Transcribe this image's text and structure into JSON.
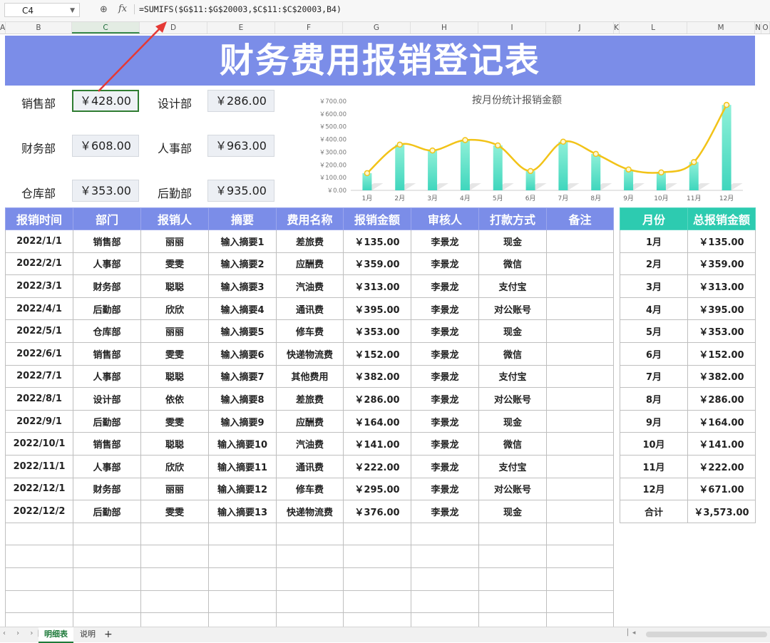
{
  "formula_bar": {
    "cell_ref": "C4",
    "fx": "fx",
    "formula": "=SUMIFS($G$11:$G$20003,$C$11:$C$20003,B4)"
  },
  "columns": [
    "A",
    "B",
    "C",
    "D",
    "E",
    "F",
    "G",
    "H",
    "I",
    "J",
    "K",
    "L",
    "M",
    "N",
    "O"
  ],
  "title": "财务费用报销登记表",
  "dept_summary": [
    {
      "label": "销售部",
      "value": "￥428.00"
    },
    {
      "label": "设计部",
      "value": "￥286.00"
    },
    {
      "label": "财务部",
      "value": "￥608.00"
    },
    {
      "label": "人事部",
      "value": "￥963.00"
    },
    {
      "label": "仓库部",
      "value": "￥353.00"
    },
    {
      "label": "后勤部",
      "value": "￥935.00"
    }
  ],
  "chart_data": {
    "type": "bar",
    "title": "按月份统计报销金额",
    "categories": [
      "1月",
      "2月",
      "3月",
      "4月",
      "5月",
      "6月",
      "7月",
      "8月",
      "9月",
      "10月",
      "11月",
      "12月"
    ],
    "values": [
      135,
      359,
      313,
      395,
      353,
      152,
      382,
      286,
      164,
      141,
      222,
      671
    ],
    "yticks": [
      "￥0.00",
      "￥100.00",
      "￥200.00",
      "￥300.00",
      "￥400.00",
      "￥500.00",
      "￥600.00",
      "￥700.00"
    ],
    "ylim": [
      0,
      700
    ],
    "overlay": "smooth line",
    "colors": {
      "bar": "#3fd6bd",
      "line": "#f2c318"
    }
  },
  "main_table": {
    "headers": [
      "报销时间",
      "部门",
      "报销人",
      "摘要",
      "费用名称",
      "报销金额",
      "审核人",
      "打款方式",
      "备注"
    ],
    "rows": [
      [
        "2022/1/1",
        "销售部",
        "丽丽",
        "输入摘要1",
        "差旅费",
        "￥135.00",
        "李景龙",
        "现金",
        ""
      ],
      [
        "2022/2/1",
        "人事部",
        "雯雯",
        "输入摘要2",
        "应酬费",
        "￥359.00",
        "李景龙",
        "微信",
        ""
      ],
      [
        "2022/3/1",
        "财务部",
        "聪聪",
        "输入摘要3",
        "汽油费",
        "￥313.00",
        "李景龙",
        "支付宝",
        ""
      ],
      [
        "2022/4/1",
        "后勤部",
        "欣欣",
        "输入摘要4",
        "通讯费",
        "￥395.00",
        "李景龙",
        "对公账号",
        ""
      ],
      [
        "2022/5/1",
        "仓库部",
        "丽丽",
        "输入摘要5",
        "修车费",
        "￥353.00",
        "李景龙",
        "现金",
        ""
      ],
      [
        "2022/6/1",
        "销售部",
        "雯雯",
        "输入摘要6",
        "快递物流费",
        "￥152.00",
        "李景龙",
        "微信",
        ""
      ],
      [
        "2022/7/1",
        "人事部",
        "聪聪",
        "输入摘要7",
        "其他费用",
        "￥382.00",
        "李景龙",
        "支付宝",
        ""
      ],
      [
        "2022/8/1",
        "设计部",
        "依依",
        "输入摘要8",
        "差旅费",
        "￥286.00",
        "李景龙",
        "对公账号",
        ""
      ],
      [
        "2022/9/1",
        "后勤部",
        "雯雯",
        "输入摘要9",
        "应酬费",
        "￥164.00",
        "李景龙",
        "现金",
        ""
      ],
      [
        "2022/10/1",
        "销售部",
        "聪聪",
        "输入摘要10",
        "汽油费",
        "￥141.00",
        "李景龙",
        "微信",
        ""
      ],
      [
        "2022/11/1",
        "人事部",
        "欣欣",
        "输入摘要11",
        "通讯费",
        "￥222.00",
        "李景龙",
        "支付宝",
        ""
      ],
      [
        "2022/12/1",
        "财务部",
        "丽丽",
        "输入摘要12",
        "修车费",
        "￥295.00",
        "李景龙",
        "对公账号",
        ""
      ],
      [
        "2022/12/2",
        "后勤部",
        "雯雯",
        "输入摘要13",
        "快递物流费",
        "￥376.00",
        "李景龙",
        "现金",
        ""
      ]
    ]
  },
  "month_table": {
    "headers": [
      "月份",
      "总报销金额"
    ],
    "rows": [
      [
        "1月",
        "￥135.00"
      ],
      [
        "2月",
        "￥359.00"
      ],
      [
        "3月",
        "￥313.00"
      ],
      [
        "4月",
        "￥395.00"
      ],
      [
        "5月",
        "￥353.00"
      ],
      [
        "6月",
        "￥152.00"
      ],
      [
        "7月",
        "￥382.00"
      ],
      [
        "8月",
        "￥286.00"
      ],
      [
        "9月",
        "￥164.00"
      ],
      [
        "10月",
        "￥141.00"
      ],
      [
        "11月",
        "￥222.00"
      ],
      [
        "12月",
        "￥671.00"
      ],
      [
        "合计",
        "￥3,573.00"
      ]
    ]
  },
  "sheet_tabs": [
    "明细表",
    "说明"
  ],
  "active_tab": "明细表"
}
